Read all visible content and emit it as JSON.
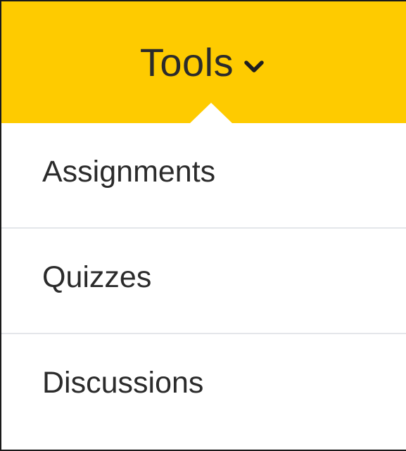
{
  "nav": {
    "label": "Tools",
    "icon": "chevron-down-icon",
    "background_color": "#fecb00"
  },
  "menu": {
    "items": [
      {
        "label": "Assignments"
      },
      {
        "label": "Quizzes"
      },
      {
        "label": "Discussions"
      }
    ]
  }
}
